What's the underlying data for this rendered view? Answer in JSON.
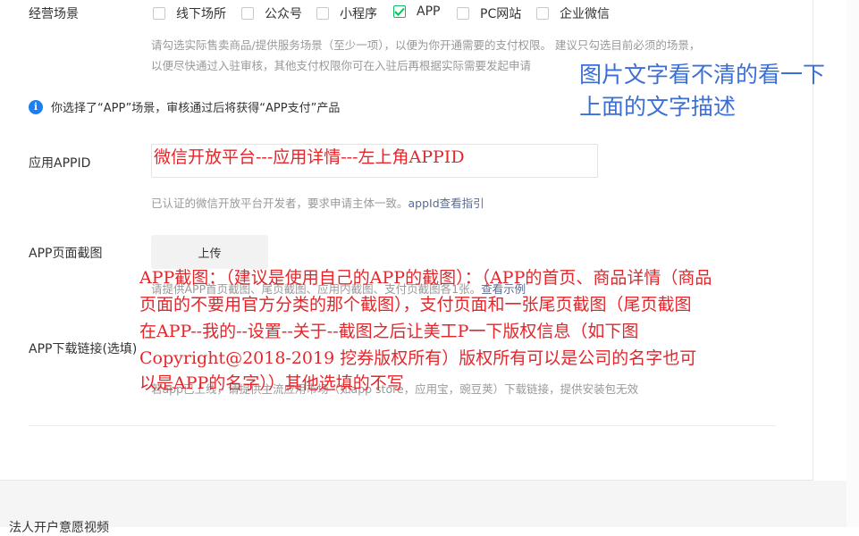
{
  "scenes": {
    "label": "经营场景",
    "options": [
      {
        "label": "线下场所",
        "checked": false
      },
      {
        "label": "公众号",
        "checked": false
      },
      {
        "label": "小程序",
        "checked": false
      },
      {
        "label": "APP",
        "checked": true
      },
      {
        "label": "PC网站",
        "checked": false
      },
      {
        "label": "企业微信",
        "checked": false
      }
    ],
    "help_line1": "请勾选实际售卖商品/提供服务场景（至少一项），以便为你开通需要的支付权限。 建议只勾选目前必须的场景，",
    "help_line2": "以便尽快通过入驻审核，其他支付权限你可在入驻后再根据实际需要发起申请"
  },
  "notice": {
    "text": "你选择了“APP”场景，审核通过后将获得“APP支付”产品"
  },
  "appid": {
    "label": "应用APPID",
    "value": "",
    "help_prefix": "已认证的微信开放平台开发者，要求申请主体一致。",
    "help_link": "appId查看指引"
  },
  "screenshot": {
    "label": "APP页面截图",
    "upload_label": "上传",
    "help": "请提供APP首页截图、尾页截图、应用内截图、支付页截图各1张。",
    "help_link": "查看示例"
  },
  "download": {
    "label": "APP下载链接(选填)",
    "help": "若app已上线，请提供主流应用市场（如app store，应用宝，豌豆荚）下载链接，提供安装包无效"
  },
  "bottom_section": {
    "title": "法人开户意愿视频"
  },
  "annotations": {
    "blue_line1": "图片文字看不清的看一下",
    "blue_line2": "上面的文字描述",
    "red_appid": "微信开放平台---应用详情---左上角APPID",
    "red_lines": [
      "APP截图：（建议是使用自己的APP的截图）：（APP的首页、商品详情（商品",
      "页面的不要用官方分类的那个截图），支付页面和一张尾页截图（尾页截图",
      "在APP--我的--设置--关于--截图之后让美工P一下版权信息（如下图",
      "Copyright@2018-2019       挖券版权所有）版权所有可以是公司的名字也可",
      "以是APP的名字））其他选填的不写"
    ]
  }
}
